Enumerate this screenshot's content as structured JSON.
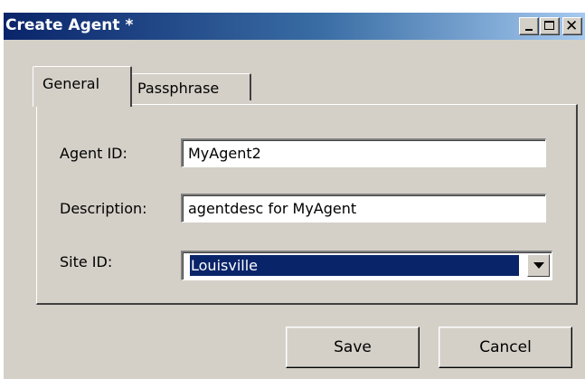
{
  "window": {
    "title": "Create Agent *",
    "titlebar_buttons": {
      "minimize_icon": "minimize-icon",
      "maximize_icon": "maximize-icon",
      "close_icon": "close-icon",
      "close_glyph": "✕"
    }
  },
  "tabs": [
    {
      "label": "General",
      "selected": true
    },
    {
      "label": "Passphrase",
      "selected": false
    }
  ],
  "form": {
    "agent_id": {
      "label": "Agent ID:",
      "value": "MyAgent2"
    },
    "description": {
      "label": "Description:",
      "value": "agentdesc for MyAgent"
    },
    "site_id": {
      "label": "Site ID:",
      "value": "Louisville",
      "arrow_icon": "chevron-down-icon"
    }
  },
  "buttons": {
    "save": "Save",
    "cancel": "Cancel"
  },
  "colors": {
    "title_bar_start": "#0a246a",
    "title_bar_end": "#a6caf0",
    "face": "#d4d0c8",
    "selection": "#0a246a"
  }
}
